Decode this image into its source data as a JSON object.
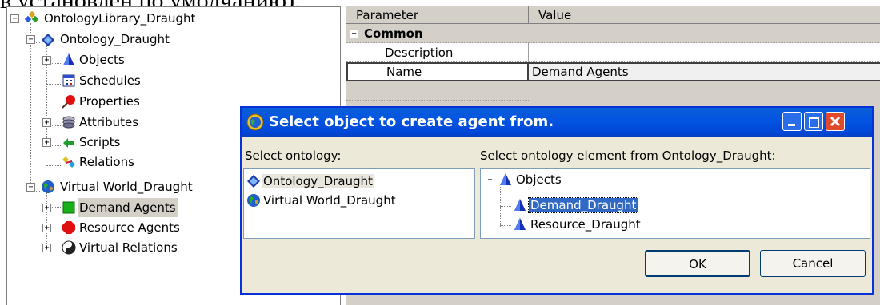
{
  "caption": {
    "text": "в установлен по умолчанию)."
  },
  "tree": {
    "root": "OntologyLibrary_Draught",
    "items": [
      {
        "label": "Ontology_Draught"
      },
      {
        "label": "Objects"
      },
      {
        "label": "Schedules"
      },
      {
        "label": "Properties"
      },
      {
        "label": "Attributes"
      },
      {
        "label": "Scripts"
      },
      {
        "label": "Relations"
      },
      {
        "label": "Virtual World_Draught"
      },
      {
        "label": "Demand Agents"
      },
      {
        "label": "Resource Agents"
      },
      {
        "label": "Virtual Relations"
      }
    ]
  },
  "grid": {
    "col_parameter": "Parameter",
    "col_value": "Value",
    "section_common": "Common",
    "row_description": "Description",
    "row_name": "Name",
    "row_name_value": "Demand Agents"
  },
  "dialog": {
    "title": "Select object to create agent from.",
    "left_label": "Select ontology:",
    "right_label": "Select ontology element from Ontology_Draught:",
    "ontologies": [
      "Ontology_Draught",
      "Virtual World_Draught"
    ],
    "elements_root": "Objects",
    "elements": [
      "Demand_Draught",
      "Resource_Draught"
    ],
    "ok_label": "OK",
    "cancel_label": "Cancel"
  }
}
